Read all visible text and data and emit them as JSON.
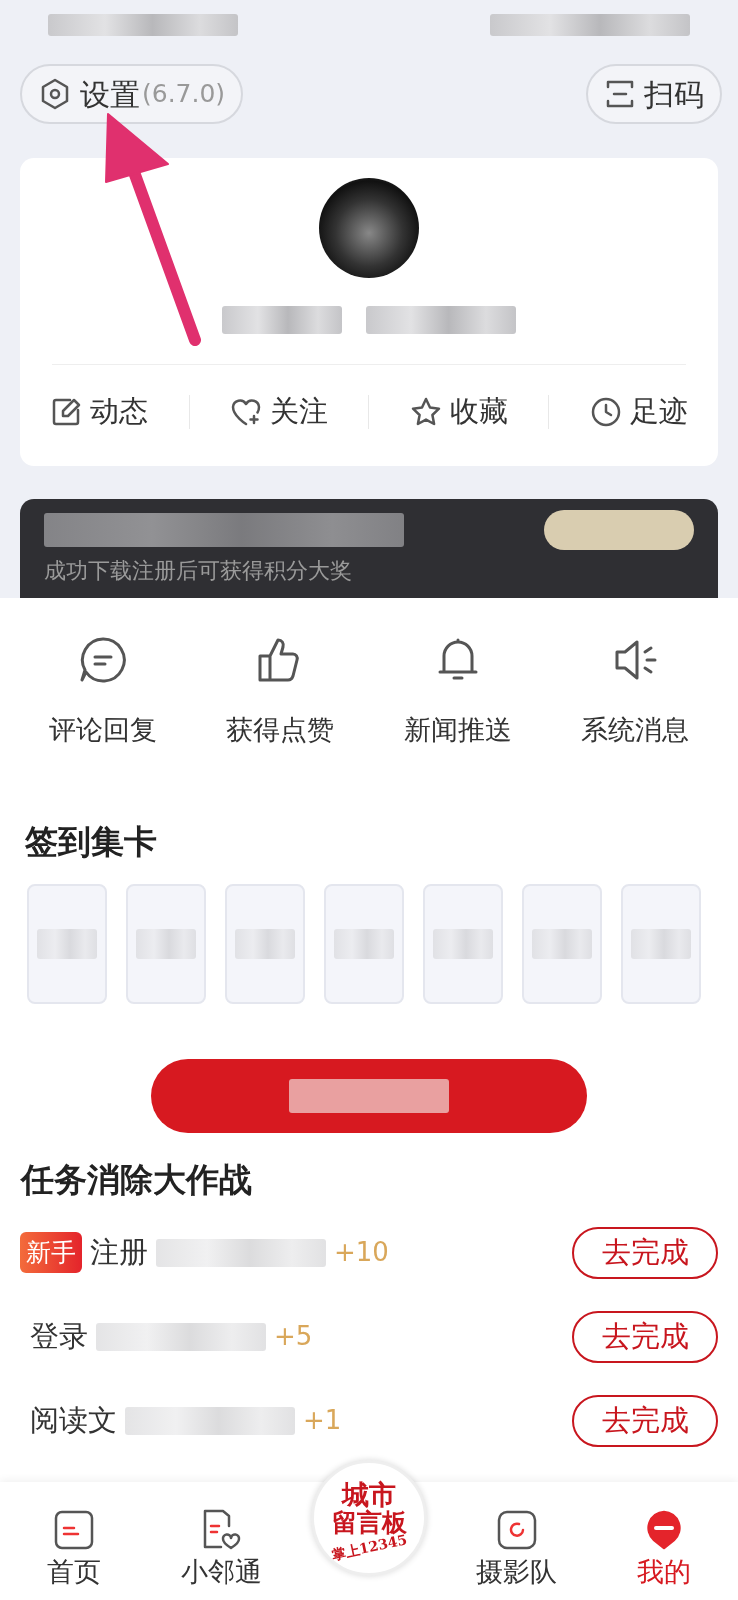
{
  "header": {
    "settings": {
      "label": "设置",
      "version": "(6.7.0)"
    },
    "scan": {
      "label": "扫码"
    }
  },
  "profile": {
    "actions": [
      {
        "label": "动态",
        "kind": "edit"
      },
      {
        "label": "关注",
        "kind": "heart"
      },
      {
        "label": "收藏",
        "kind": "star"
      },
      {
        "label": "足迹",
        "kind": "clock"
      }
    ]
  },
  "invite": {
    "subtitle": "成功下载注册后可获得积分大奖"
  },
  "messages": [
    {
      "label": "评论回复",
      "kind": "comment"
    },
    {
      "label": "获得点赞",
      "kind": "thumb"
    },
    {
      "label": "新闻推送",
      "kind": "bell"
    },
    {
      "label": "系统消息",
      "kind": "speaker"
    }
  ],
  "checkin": {
    "title": "签到集卡"
  },
  "tasks": {
    "title": "任务消除大作战",
    "items": [
      {
        "badge": "新手",
        "name": "注册",
        "points": "+10",
        "button": "去完成"
      },
      {
        "name": "登录",
        "points": "+5",
        "button": "去完成"
      },
      {
        "name": "阅读文",
        "points": "+1",
        "button": "去完成"
      }
    ]
  },
  "nav": {
    "items": [
      {
        "kind": "tab",
        "label": "首页",
        "selected": false
      },
      {
        "kind": "tab",
        "label": "小邻通",
        "selected": false
      },
      {
        "kind": "logo",
        "lines": [
          "城市",
          "留言板"
        ],
        "sub": "掌上12345"
      },
      {
        "kind": "tab",
        "label": "摄影队",
        "selected": false
      },
      {
        "kind": "tab",
        "label": "我的",
        "selected": true
      }
    ]
  }
}
